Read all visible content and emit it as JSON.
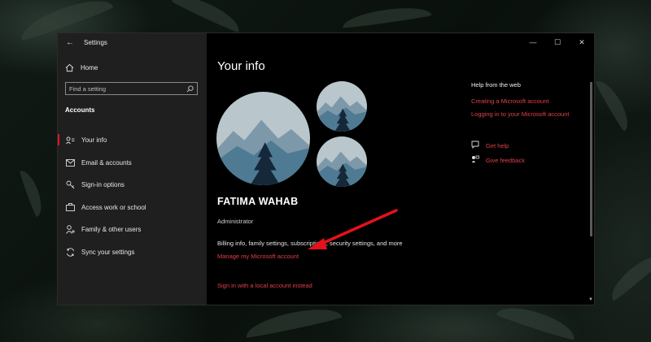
{
  "window": {
    "app_title": "Settings",
    "caption": {
      "minimize": "—",
      "maximize": "☐",
      "close": "✕"
    }
  },
  "sidebar": {
    "home_label": "Home",
    "search_placeholder": "Find a setting",
    "section_title": "Accounts",
    "items": [
      {
        "label": "Your info",
        "icon": "person-card-icon",
        "active": true
      },
      {
        "label": "Email & accounts",
        "icon": "mail-icon"
      },
      {
        "label": "Sign-in options",
        "icon": "key-icon"
      },
      {
        "label": "Access work or school",
        "icon": "briefcase-icon"
      },
      {
        "label": "Family & other users",
        "icon": "person-plus-icon"
      },
      {
        "label": "Sync your settings",
        "icon": "sync-icon"
      }
    ]
  },
  "main": {
    "page_title": "Your info",
    "user_name": "FATIMA WAHAB",
    "user_role": "Administrator",
    "billing_text": "Billing info, family settings, subscriptions, security settings, and more",
    "manage_link": "Manage my Microsoft account",
    "local_link": "Sign in with a local account instead"
  },
  "help": {
    "title": "Help from the web",
    "links": [
      "Creating a Microsoft account",
      "Logging in to your Microsoft account"
    ],
    "get_help": "Get help",
    "give_feedback": "Give feedback"
  },
  "colors": {
    "accent": "#e0404a",
    "active_indicator": "#e81123",
    "sidebar_bg": "#1f1f1f",
    "content_bg": "#000000",
    "annotation_arrow": "#e3121b"
  }
}
